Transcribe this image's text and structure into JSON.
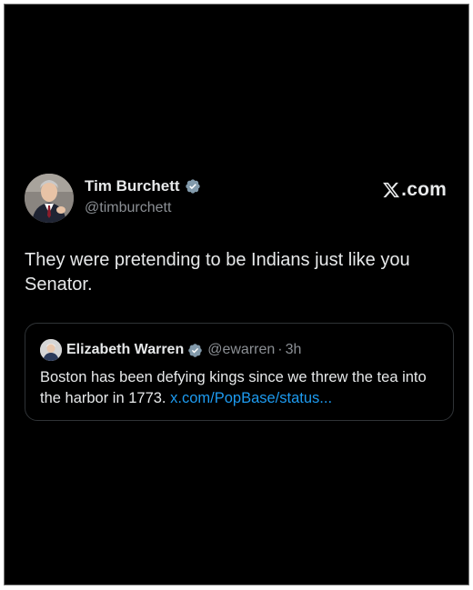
{
  "post": {
    "author": {
      "name": "Tim Burchett",
      "handle": "@timburchett",
      "verified": true
    },
    "brand": "X.com",
    "text": "They were pretending to be Indians just like you Senator.",
    "quoted": {
      "author": {
        "name": "Elizabeth Warren",
        "handle": "@ewarren",
        "separator": "·",
        "time": "3h",
        "verified": true
      },
      "text": "Boston has been defying kings since we threw the tea into the harbor in 1773.",
      "link": "x.com/PopBase/status..."
    }
  },
  "colors": {
    "background": "#000000",
    "text_primary": "#e7e9ea",
    "text_secondary": "#8b8f94",
    "link": "#1d9bf0",
    "border": "#2f3336",
    "verified_badge": "#829aab"
  },
  "icons": {
    "verified": "verified-badge-icon",
    "brand": "x-logo-icon"
  }
}
